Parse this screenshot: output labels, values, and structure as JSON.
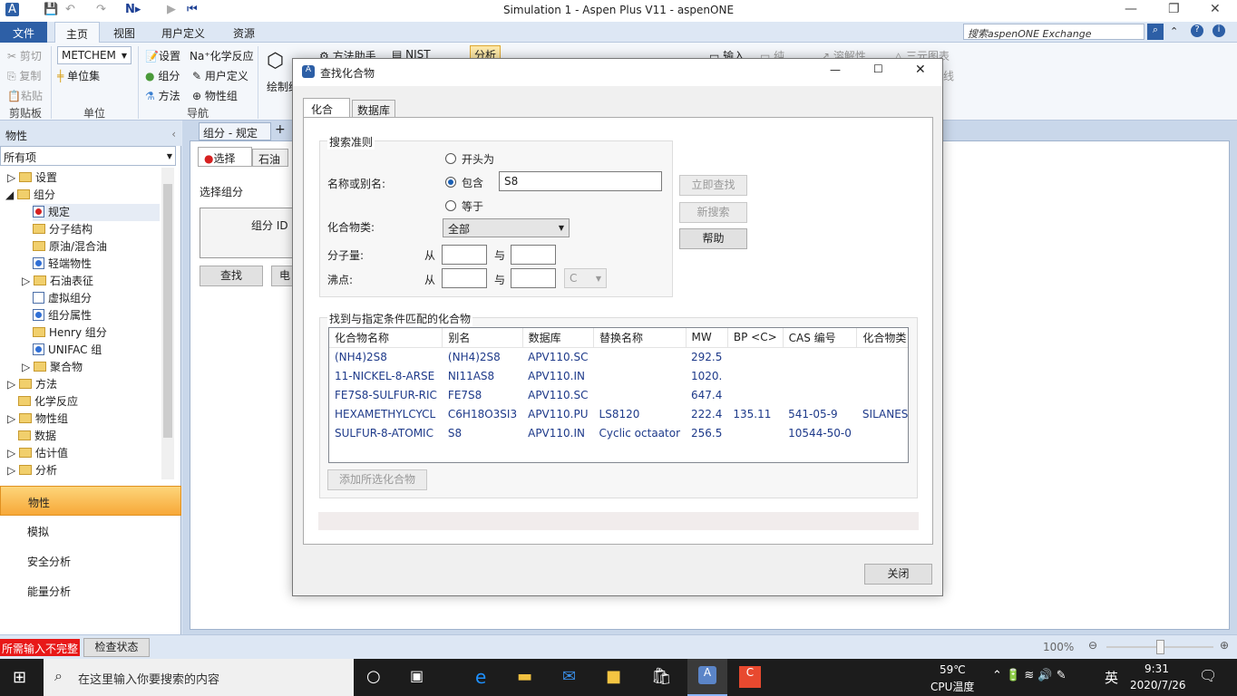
{
  "window": {
    "title": "Simulation 1 - Aspen Plus V11 - aspenONE",
    "search_placeholder": "搜索aspenONE Exchange"
  },
  "ribbon_tabs": [
    "文件",
    "主页",
    "视图",
    "用户定义",
    "资源"
  ],
  "ribbon": {
    "clipboard": {
      "cut": "剪切",
      "copy": "复制",
      "paste": "粘贴",
      "group": "剪贴板"
    },
    "units": {
      "select": "METCHEM",
      "unit_sets": "单位集",
      "group": "单位"
    },
    "navigate": {
      "setup": "设置",
      "chem": "化学反应",
      "components": "组分",
      "custom": "用户定义",
      "methods": "方法",
      "propsets": "物性组",
      "group": "导航"
    },
    "draw": "绘制结",
    "method_assist": "方法助手",
    "nist": "NIST",
    "analysis": "分析",
    "input": "输入",
    "pure": "纯",
    "decomp": "溶解性",
    "ternary": "三元图表",
    "line": "线"
  },
  "left": {
    "header": "物性",
    "filter": "所有项",
    "tree": [
      {
        "label": "设置"
      },
      {
        "label": "组分"
      },
      {
        "label": "规定"
      },
      {
        "label": "分子结构"
      },
      {
        "label": "原油/混合油"
      },
      {
        "label": "轻端物性"
      },
      {
        "label": "石油表征"
      },
      {
        "label": "虚拟组分"
      },
      {
        "label": "组分属性"
      },
      {
        "label": "Henry 组分"
      },
      {
        "label": "UNIFAC 组"
      },
      {
        "label": "聚合物"
      },
      {
        "label": "方法"
      },
      {
        "label": "化学反应"
      },
      {
        "label": "物性组"
      },
      {
        "label": "数据"
      },
      {
        "label": "估计值"
      },
      {
        "label": "分析"
      }
    ],
    "nav": [
      "物性",
      "模拟",
      "安全分析",
      "能量分析"
    ]
  },
  "doc": {
    "tab": "组分 - 规定",
    "subtabs": [
      "选择",
      "石油"
    ],
    "section": "选择组分",
    "col": "组分 ID",
    "find": "查找",
    "elec": "电"
  },
  "dialog": {
    "title": "查找化合物",
    "tabs": [
      "化合物",
      "数据库"
    ],
    "criteria": "搜索准则",
    "name_label": "名称或别名:",
    "starts": "开头为",
    "contains": "包含",
    "equals": "等于",
    "query": "S8",
    "class_label": "化合物类:",
    "class_value": "全部",
    "mw_label": "分子量:",
    "from": "从",
    "to": "与",
    "bp_label": "沸点:",
    "bp_unit": "C",
    "find_now": "立即查找",
    "new_search": "新搜索",
    "help": "帮助",
    "results_label": "找到与指定条件匹配的化合物",
    "columns": [
      "化合物名称",
      "别名",
      "数据库",
      "替换名称",
      "MW",
      "BP <C>",
      "CAS 编号",
      "化合物类"
    ],
    "rows": [
      [
        "(NH4)2S8",
        "(NH4)2S8",
        "APV110.SC",
        "",
        "292.5",
        "",
        "",
        ""
      ],
      [
        "11-NICKEL-8-ARSE",
        "NI11AS8",
        "APV110.IN",
        "",
        "1020.",
        "",
        "",
        ""
      ],
      [
        "FE7S8-SULFUR-RIC",
        "FE7S8",
        "APV110.SC",
        "",
        "647.4",
        "",
        "",
        ""
      ],
      [
        "HEXAMETHYLCYCL",
        "C6H18O3SI3",
        "APV110.PU",
        "LS8120",
        "222.4",
        "135.11",
        "541-05-9",
        "SILANES/SILOXA"
      ],
      [
        "SULFUR-8-ATOMIC",
        "S8",
        "APV110.IN",
        "Cyclic octaator",
        "256.5",
        "",
        "10544-50-0",
        ""
      ]
    ],
    "add_selected": "添加所选化合物",
    "close": "关闭"
  },
  "status": {
    "required": "所需输入不完整",
    "check": "检查状态",
    "zoom": "100%",
    "zoom_level": 0.5
  },
  "taskbar": {
    "search": "在这里输入你要搜索的内容",
    "temp": "59℃",
    "temp_label": "CPU温度",
    "ime": "英",
    "time": "9:31",
    "date": "2020/7/26"
  }
}
